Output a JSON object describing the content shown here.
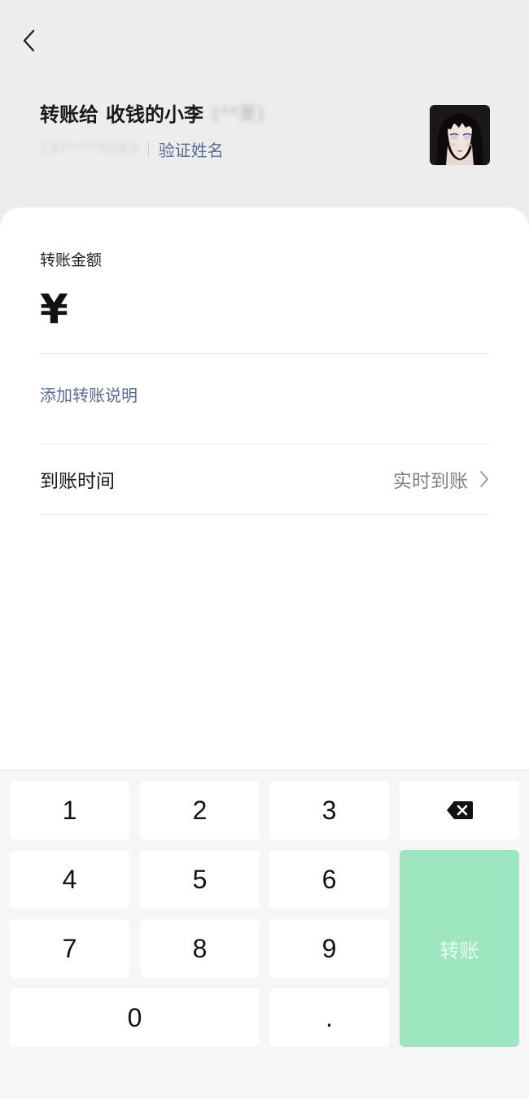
{
  "header": {
    "title_prefix": "转账给",
    "recipient_name": "收钱的小李",
    "masked_name": "(**夏)",
    "masked_account": "137****6083",
    "verify_label": "验证姓名"
  },
  "transfer": {
    "amount_label": "转账金额",
    "currency_symbol": "¥",
    "amount_value": "",
    "add_note_label": "添加转账说明",
    "arrival_label": "到账时间",
    "arrival_value": "实时到账"
  },
  "keypad": {
    "keys": [
      "1",
      "2",
      "3",
      "4",
      "5",
      "6",
      "7",
      "8",
      "9",
      "0",
      "."
    ],
    "transfer_label": "转账",
    "backspace_icon": "backspace-icon"
  },
  "colors": {
    "link": "#576b95",
    "transfer_button": "#9de6c0",
    "background": "#ededed"
  }
}
